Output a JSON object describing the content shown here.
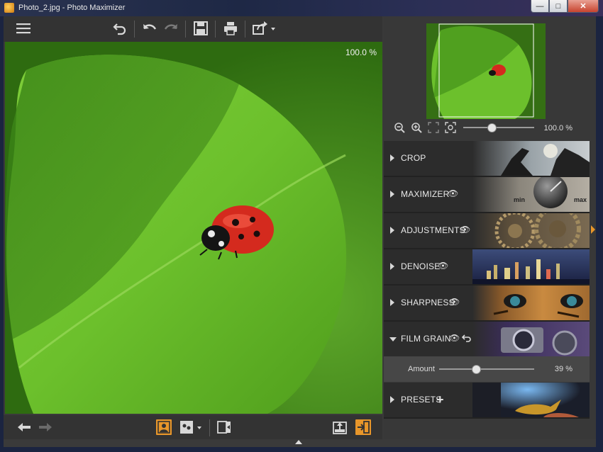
{
  "window": {
    "title": "Photo_2.jpg - Photo Maximizer"
  },
  "canvas": {
    "zoom_label": "100.0 %"
  },
  "navigator": {
    "zoom_label": "100.0 %",
    "zoom_level": 0.4
  },
  "sections": [
    {
      "label": "CROP"
    },
    {
      "label": "MAXIMIZER",
      "min_label": "min",
      "max_label": "max"
    },
    {
      "label": "ADJUSTMENTS"
    },
    {
      "label": "DENOISE"
    },
    {
      "label": "SHARPNESS"
    },
    {
      "label": "FILM GRAIN"
    },
    {
      "label": "PRESETS"
    }
  ],
  "film_grain": {
    "amount_label": "Amount",
    "amount_value": "39 %",
    "amount_level": 0.39
  },
  "colors": {
    "accent": "#e8962a",
    "panel": "#383838",
    "section": "#2c2c2c"
  }
}
